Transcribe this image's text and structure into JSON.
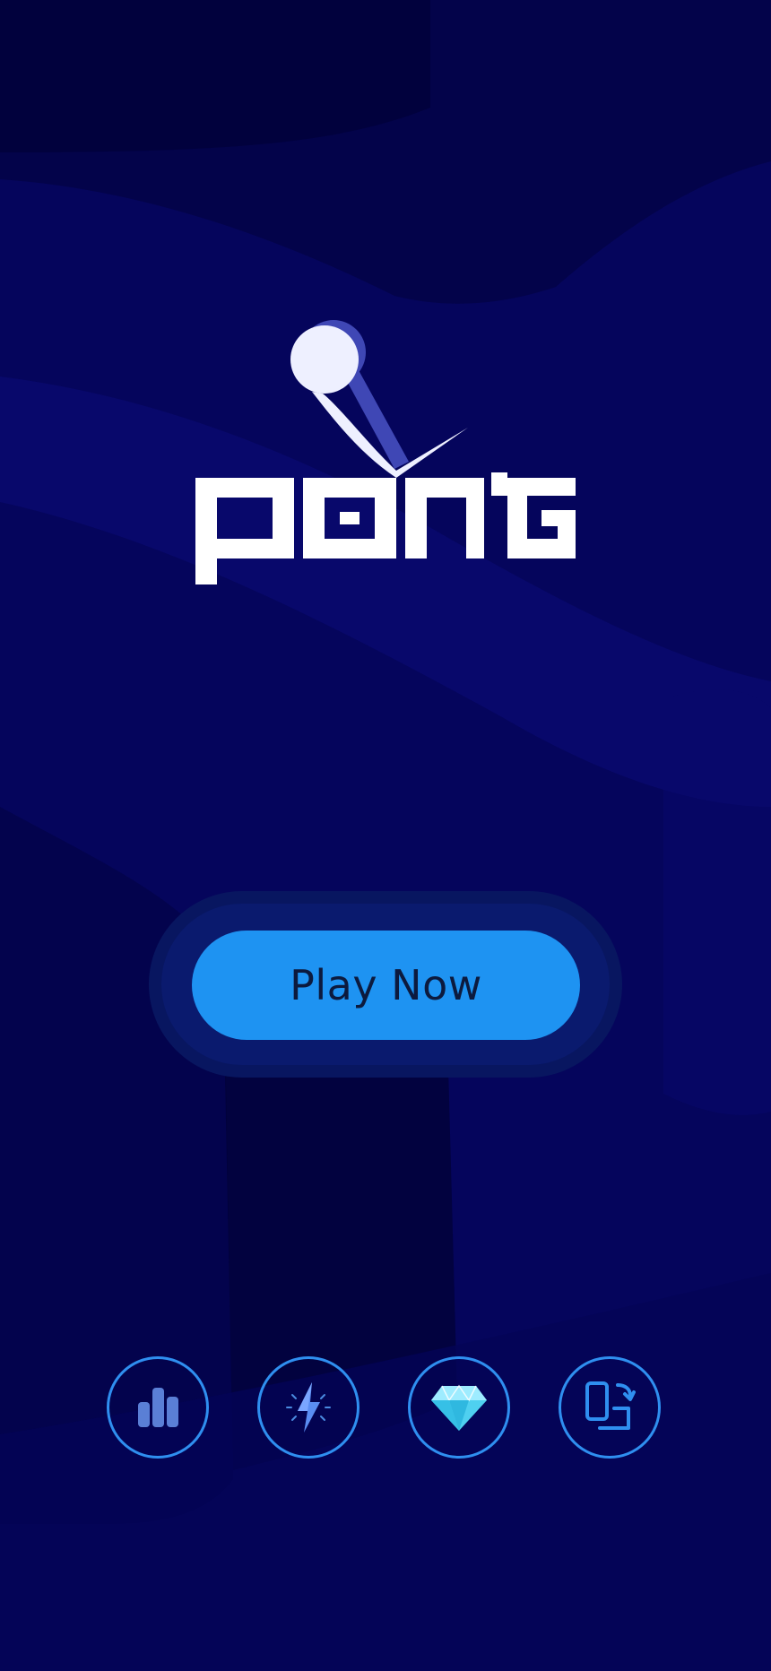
{
  "colors": {
    "background": "#05055c",
    "background_dark": "#02023a",
    "background_light": "#0a0a74",
    "accent": "#1e93f2",
    "icon_ring": "#2f8ff0",
    "button_text": "#0c1a3e",
    "logo_white": "#ffffff"
  },
  "logo": {
    "text": "PONG",
    "icon": "pong-logo-icon"
  },
  "play": {
    "label": "Play Now"
  },
  "bottom_icons": [
    {
      "name": "leaderboard-icon"
    },
    {
      "name": "lightning-bolt-icon"
    },
    {
      "name": "diamond-icon"
    },
    {
      "name": "device-switch-icon"
    }
  ]
}
